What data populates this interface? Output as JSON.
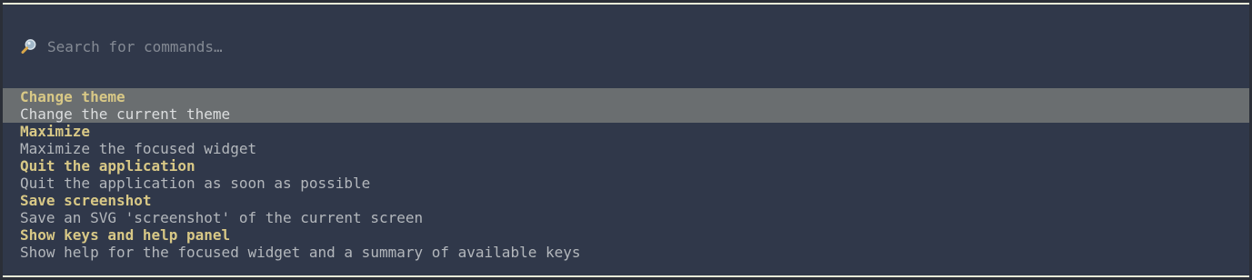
{
  "search": {
    "placeholder": "Search for commands…",
    "value": "",
    "icon": "magnifier-icon"
  },
  "commands": [
    {
      "title": "Change theme",
      "description": "Change the current theme",
      "highlighted": true
    },
    {
      "title": "Maximize",
      "description": "Maximize the focused widget",
      "highlighted": false
    },
    {
      "title": "Quit the application",
      "description": "Quit the application as soon as possible",
      "highlighted": false
    },
    {
      "title": "Save screenshot",
      "description": "Save an SVG 'screenshot' of the current screen",
      "highlighted": false
    },
    {
      "title": "Show keys and help panel",
      "description": "Show help for the focused widget and a summary of available keys",
      "highlighted": false
    }
  ],
  "colors": {
    "background": "#30384a",
    "highlight": "#6a6e70",
    "title": "#d8c886",
    "description": "#b3b7bc",
    "border": "#e8ecd8"
  }
}
